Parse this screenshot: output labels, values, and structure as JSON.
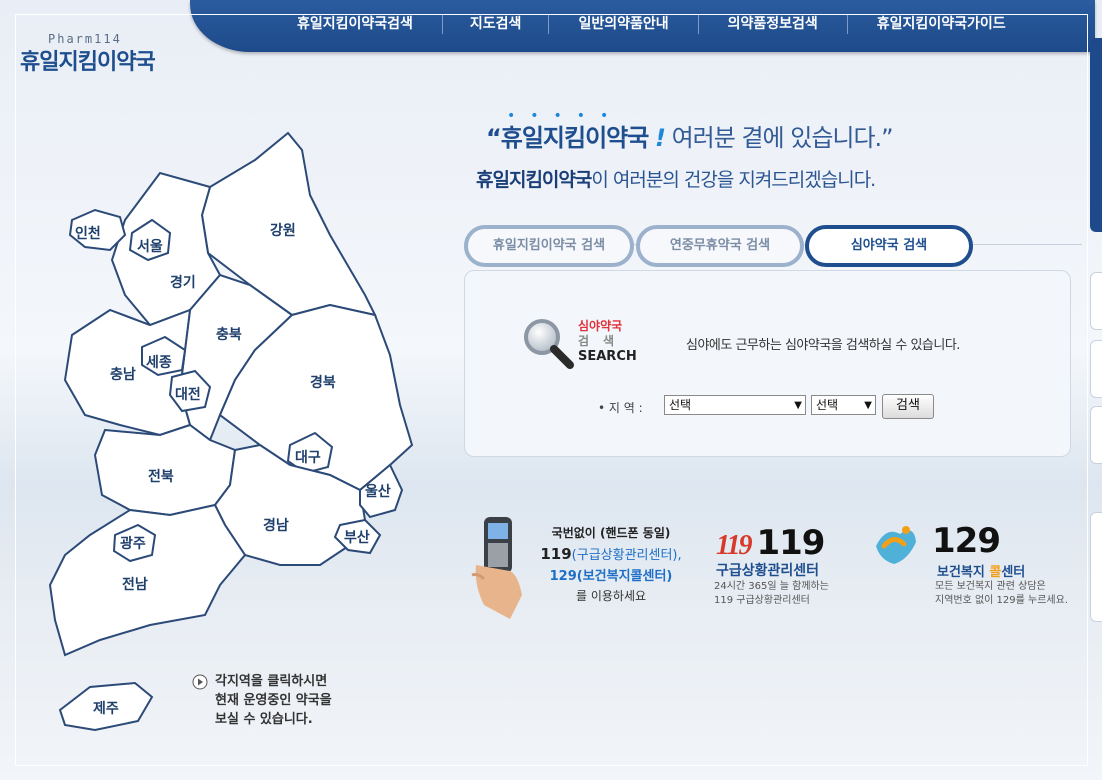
{
  "nav": {
    "items": [
      "휴일지킴이약국검색",
      "지도검색",
      "일반의약품안내",
      "의약품정보검색",
      "휴일지킴이약국가이드"
    ]
  },
  "logo": {
    "english": "Pharm114",
    "korean": "휴일지킴이약국"
  },
  "headline": {
    "line1_strong": "“휴일지킴이약국",
    "line1_excl": "!",
    "line1_rest": "여러분 곁에 있습니다.”",
    "line2_strong": "휴일지킴이약국",
    "line2_rest": "이 여러분의 건강을 지켜드리겠습니다."
  },
  "search_tabs": [
    {
      "label": "휴일지킴이약국 검색",
      "active": false
    },
    {
      "label": "연중무휴약국 검색",
      "active": false
    },
    {
      "label": "심야약국 검색",
      "active": true
    }
  ],
  "search_panel": {
    "title_line1": "심야약국",
    "title_line2": "검색",
    "title_line3": "SEARCH",
    "description": "심야에도 근무하는 심야약국을 검색하실 수 있습니다.",
    "region_label": "• 지 역 :",
    "select1_value": "선택",
    "select2_value": "선택",
    "search_button": "검색"
  },
  "emergency": {
    "a_line1": "국번없이 (핸드폰 동일)",
    "a_line2_num": "119",
    "a_line2_paren": "(구급상황관리센터),",
    "a_line3": "129(보건복지콜센터)",
    "a_line4": "를 이용하세요",
    "b_mark": "119",
    "b_number": "119",
    "b_name": "구급상황관리센터",
    "b_desc1": "24시간 365일 늘 함께하는",
    "b_desc2": "119 구급상황관리센터",
    "c_number": "129",
    "c_name_pre": "보건복지 ",
    "c_name_hl": "콜",
    "c_name_post": "센터",
    "c_desc1": "모든 보건복지 관련 상담은",
    "c_desc2": "지역번호 없이 129를 누르세요."
  },
  "map": {
    "regions": {
      "incheon": "인천",
      "seoul": "서울",
      "gyeonggi": "경기",
      "gangwon": "강원",
      "chungbuk": "충북",
      "chungnam": "충남",
      "sejong": "세종",
      "daejeon": "대전",
      "gyeongbuk": "경북",
      "daegu": "대구",
      "jeonbuk": "전북",
      "ulsan": "울산",
      "gyeongnam": "경남",
      "busan": "부산",
      "gwangju": "광주",
      "jeonnam": "전남",
      "jeju": "제주"
    },
    "hint_line1": "각지역을 클릭하시면",
    "hint_line2": "현재 운영중인 약국을",
    "hint_line3": "보실 수 있습니다."
  },
  "colors": {
    "nav_bg": "#1d4a8a",
    "brand_blue": "#1f4e8f",
    "accent_red": "#e0323a",
    "accent_orange": "#f2a019"
  }
}
